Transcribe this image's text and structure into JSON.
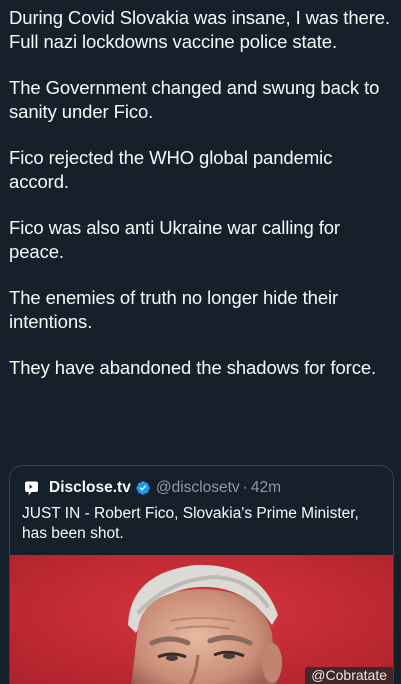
{
  "tweet": {
    "paragraphs": [
      "During Covid Slovakia was insane, I was there. Full nazi lockdowns vaccine police state.",
      "The Government changed and swung back to sanity under Fico.",
      "Fico rejected the WHO global pandemic accord.",
      "Fico was also anti Ukraine war calling for peace.",
      "The enemies of truth no longer hide their intentions.",
      "They have abandoned the shadows for force."
    ]
  },
  "quote": {
    "author_name": "Disclose.tv",
    "handle": "@disclosetv",
    "separator": "·",
    "time": "42m",
    "text": "JUST IN - Robert Fico, Slovakia's Prime Minister, has been shot.",
    "verified_color": "#1d9bf0",
    "image": {
      "background_color": "#c62a33",
      "icon": "person-photo"
    }
  },
  "watermark": "@Cobratate",
  "colors": {
    "background": "#15202b",
    "text": "#f7f9f9",
    "secondary_text": "#8b98a5",
    "border": "#38444d"
  }
}
